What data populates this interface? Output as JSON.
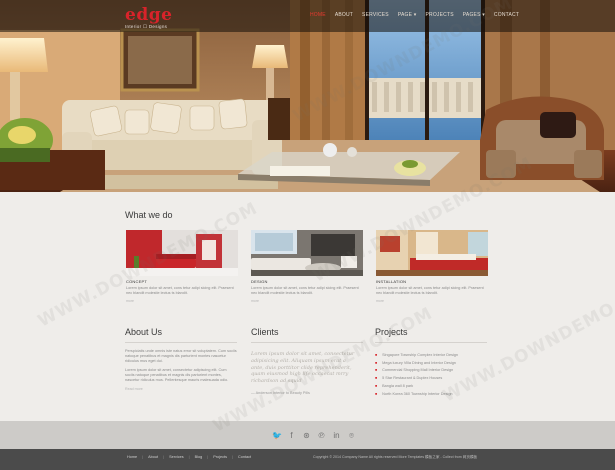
{
  "brand": {
    "logo": "edge",
    "tagline": "Interior ☐ Designs"
  },
  "nav": [
    "HOME",
    "ABOUT",
    "SERVICES",
    "PAGE ▾",
    "PROJECTS",
    "PAGES ▾",
    "CONTACT"
  ],
  "what_we_do": {
    "heading": "What we do",
    "services": [
      {
        "caption": "CONCEPT",
        "text": "Lorem ipsum dolor sit amet, cons tetur adipi sicing elit. Praesent nec blandit molestie lectus ts blandit.",
        "more": "more"
      },
      {
        "caption": "DESIGN",
        "text": "Lorem ipsum dolor sit amet, cons tetur adipi sicing elit. Praesent nec blandit molestie lectus ts blandit.",
        "more": "more"
      },
      {
        "caption": "INSTALLATION",
        "text": "Lorem ipsum dolor sit amet, cons tetur adipi sicing elit. Praesent nec blandit molestie lectus ts blandit.",
        "more": "more"
      }
    ]
  },
  "about": {
    "heading": "About Us",
    "p1": "Perspiciatis unde omnis iste natus error sit voluptatem. Cum sociis natoque penatibus et magnis dis parturient montes nascetur ridiculus mus eget dui.",
    "p2": "Lorem ipsum dolor sit amet, consectetur adipiscing elit. Cum sociis natoque penatibus et magnis dis parturient montes, nascetur ridiculus mus. Pellentesque mauris malesuada odio.",
    "more": "Read more"
  },
  "clients": {
    "heading": "Clients",
    "quote": "Lorem ipsum dolor sit amet, consectetur adipisicing elit. Aliquam ipsum erat a ante, duis porttitor clide reprehenderit, quam eiusmod high life occaecat mrry richardson ad squid",
    "author": "— Anderson Interior to Beauty Pills"
  },
  "projects": {
    "heading": "Projects",
    "items": [
      "Singapore Township Complex Interior Design",
      "Mega luxury Villa Dining and Interior Design",
      "Commercial Shopping Mall Interior Design",
      "5 Star Restaurant & Duplex Houses",
      "Bangla wall 8 park",
      "North Korea 360 Township Interior Design"
    ]
  },
  "social_icons": [
    "twitter-icon",
    "facebook-icon",
    "dribbble-icon",
    "pinterest-icon",
    "linkedin-icon",
    "github-icon"
  ],
  "social_glyphs": [
    "🐦",
    "f",
    "⊛",
    "℗",
    "in",
    "⌾"
  ],
  "footer": {
    "links": [
      "Home",
      "About",
      "Services",
      "Blog",
      "Projects",
      "Contact"
    ],
    "copyright": "Copyright © 2014 Company Name All rights reserved More Templates 模板之家 - Collect from 网页模板"
  },
  "watermark": "WWW.DOWNDEMO.COM",
  "colors": {
    "accent": "#d8232a",
    "footer": "#4b4b4b",
    "band": "#cdcbc8",
    "background": "#efedea"
  }
}
